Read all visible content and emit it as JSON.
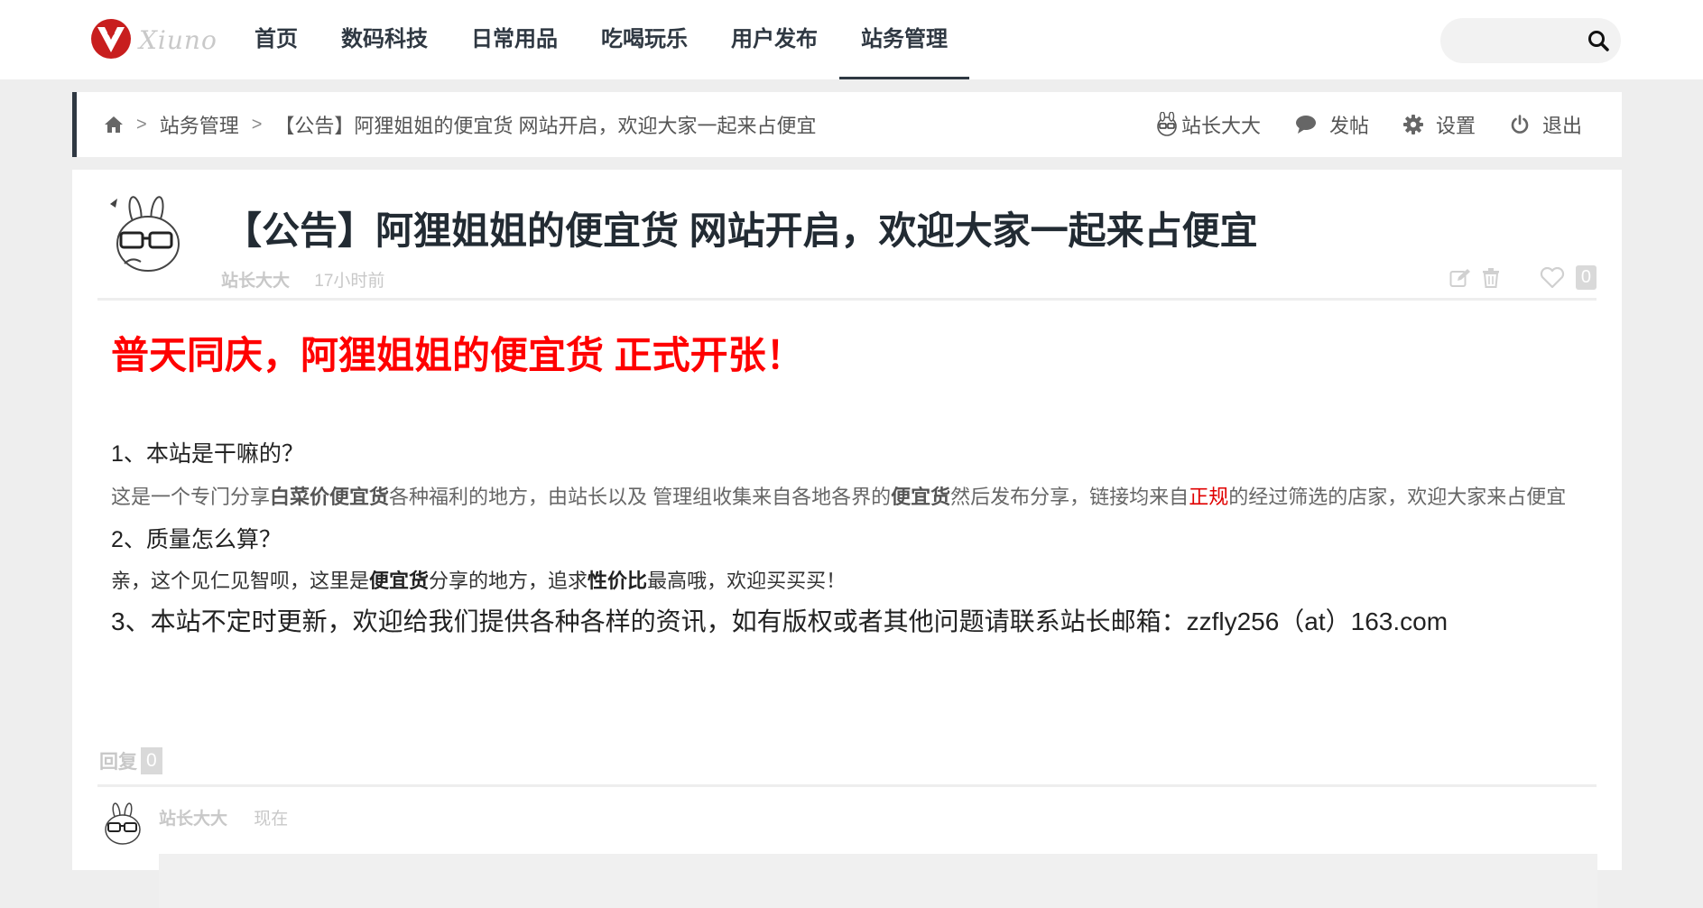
{
  "site": {
    "logo_text": "Xiuno",
    "brand_color": "#c81e1e"
  },
  "nav": {
    "items": [
      {
        "label": "首页"
      },
      {
        "label": "数码科技"
      },
      {
        "label": "日常用品"
      },
      {
        "label": "吃喝玩乐"
      },
      {
        "label": "用户发布"
      },
      {
        "label": "站务管理",
        "active": true
      }
    ]
  },
  "search": {
    "placeholder": "",
    "icon": "search-icon"
  },
  "breadcrumb": {
    "home_icon": "home-icon",
    "separator": ">",
    "items": [
      "站务管理",
      "【公告】阿狸姐姐的便宜货 网站开启，欢迎大家一起来占便宜"
    ]
  },
  "user_menu": {
    "username": "站长大大",
    "post_label": "发帖",
    "settings_label": "设置",
    "logout_label": "退出"
  },
  "post": {
    "title": "【公告】阿狸姐姐的便宜货 网站开启，欢迎大家一起来占便宜",
    "author": "站长大大",
    "time": "17小时前",
    "likes": "0",
    "headline": "普天同庆，阿狸姐姐的便宜货 正式开张！",
    "q1": "1、本站是干嘛的？",
    "a1": {
      "p1": "这是一个专门分享",
      "b1": "白菜价便宜货",
      "p2": "各种福利的地方，由站长以及 管理组收集来自各地各界的",
      "b2": "便宜货",
      "p3": "然后发布分享，链接均来自",
      "red": "正规",
      "p4": "的经过筛选的店家，欢迎大家来占便宜"
    },
    "q2": "2、质量怎么算？",
    "a2": {
      "p1": "亲，这个见仁见智呗，这里是",
      "b1": "便宜货",
      "p2": "分享的地方，追求",
      "b2": "性价比",
      "p3": "最高哦，欢迎买买买！"
    },
    "line3": "3、本站不定时更新，欢迎给我们提供各种各样的资讯，如有版权或者其他问题请联系站长邮箱：zzfly256（at）163.com"
  },
  "replies": {
    "label": "回复",
    "count": "0",
    "author": "站长大大",
    "time": "现在"
  },
  "colors": {
    "headline": "#ff0000",
    "nav_text": "#2f3842",
    "meta": "#c8c8c8",
    "page_bg": "#eeeeee"
  }
}
